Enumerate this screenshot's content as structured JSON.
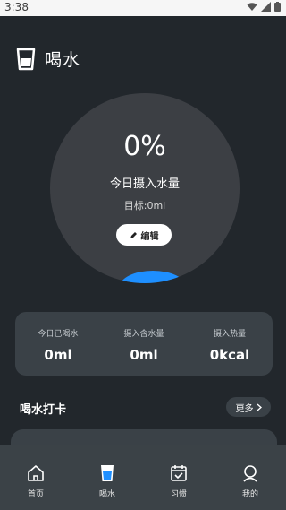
{
  "status_bar": {
    "time": "3:38"
  },
  "header": {
    "title": "喝水"
  },
  "gauge": {
    "percent_text": "0%",
    "subtitle": "今日摄入水量",
    "goal_label": "目标:",
    "goal_value": "0ml",
    "edit_label": "编辑",
    "fill_fraction": 0.0
  },
  "stats": [
    {
      "label": "今日已喝水",
      "value": "0ml"
    },
    {
      "label": "摄入含水量",
      "value": "0ml"
    },
    {
      "label": "摄入热量",
      "value": "0kcal"
    }
  ],
  "checkin": {
    "title": "喝水打卡",
    "more_label": "更多"
  },
  "tabbar": {
    "items": [
      {
        "label": "首页",
        "icon": "home-icon"
      },
      {
        "label": "喝水",
        "icon": "water-cup-icon"
      },
      {
        "label": "习惯",
        "icon": "calendar-check-icon"
      },
      {
        "label": "我的",
        "icon": "profile-icon"
      }
    ]
  },
  "colors": {
    "background": "#22272c",
    "card": "#3a4147",
    "accent": "#1e8fff"
  }
}
